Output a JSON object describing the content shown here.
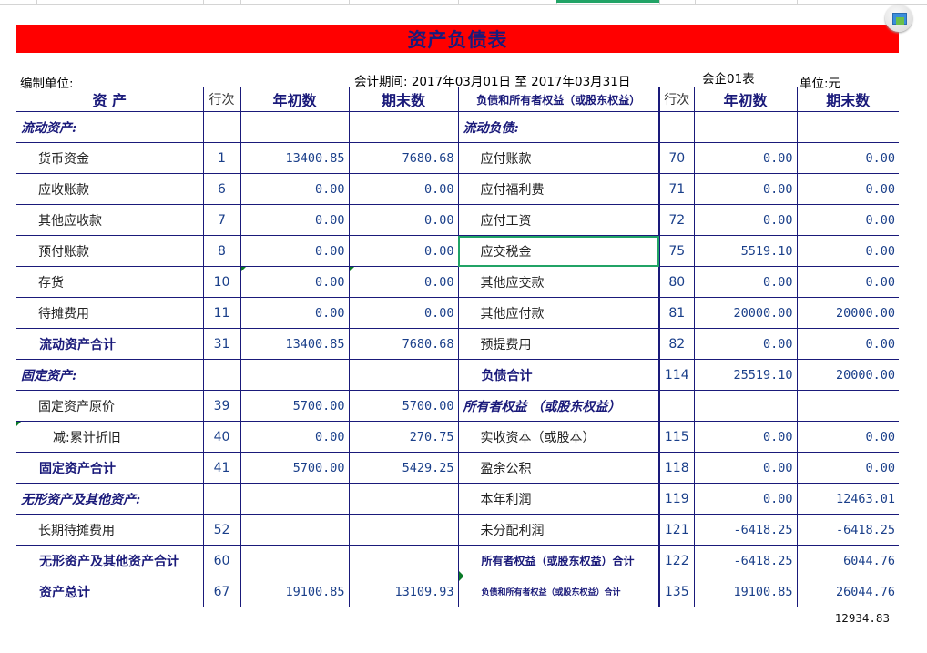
{
  "title": "资产负债表",
  "meta": {
    "unit_label": "编制单位:",
    "period": "会计期间:  2017年03月01日 至 2017年03月31日",
    "form_code": "会企01表",
    "currency": "单位:元"
  },
  "headers": {
    "assets": "资    产",
    "row_no": "行次",
    "begin": "年初数",
    "end": "期末数",
    "liabilities": "负债和所有者权益（或股东权益）"
  },
  "rows": [
    {
      "l_name": "流动资产:",
      "l_no": "",
      "l_begin": "",
      "l_end": "",
      "r_name": "流动负债:",
      "r_no": "",
      "r_begin": "",
      "r_end": ""
    },
    {
      "l_name": "货币资金",
      "l_no": "1",
      "l_begin": "13400.85",
      "l_end": "7680.68",
      "r_name": "应付账款",
      "r_no": "70",
      "r_begin": "0.00",
      "r_end": "0.00"
    },
    {
      "l_name": "应收账款",
      "l_no": "6",
      "l_begin": "0.00",
      "l_end": "0.00",
      "r_name": "应付福利费",
      "r_no": "71",
      "r_begin": "0.00",
      "r_end": "0.00"
    },
    {
      "l_name": "其他应收款",
      "l_no": "7",
      "l_begin": "0.00",
      "l_end": "0.00",
      "r_name": "应付工资",
      "r_no": "72",
      "r_begin": "0.00",
      "r_end": "0.00"
    },
    {
      "l_name": "预付账款",
      "l_no": "8",
      "l_begin": "0.00",
      "l_end": "0.00",
      "r_name": "应交税金",
      "r_no": "75",
      "r_begin": "5519.10",
      "r_end": "0.00"
    },
    {
      "l_name": "存货",
      "l_no": "10",
      "l_begin": "0.00",
      "l_end": "0.00",
      "r_name": "其他应交款",
      "r_no": "80",
      "r_begin": "0.00",
      "r_end": "0.00"
    },
    {
      "l_name": "待摊费用",
      "l_no": "11",
      "l_begin": "0.00",
      "l_end": "0.00",
      "r_name": "其他应付款",
      "r_no": "81",
      "r_begin": "20000.00",
      "r_end": "20000.00"
    },
    {
      "l_name": "流动资产合计",
      "l_no": "31",
      "l_begin": "13400.85",
      "l_end": "7680.68",
      "r_name": "预提费用",
      "r_no": "82",
      "r_begin": "0.00",
      "r_end": "0.00"
    },
    {
      "l_name": "固定资产:",
      "l_no": "",
      "l_begin": "",
      "l_end": "",
      "r_name": "负债合计",
      "r_no": "114",
      "r_begin": "25519.10",
      "r_end": "20000.00"
    },
    {
      "l_name": "固定资产原价",
      "l_no": "39",
      "l_begin": "5700.00",
      "l_end": "5700.00",
      "r_name": "所有者权益 （或股东权益）",
      "r_no": "",
      "r_begin": "",
      "r_end": ""
    },
    {
      "l_name": "减:累计折旧",
      "l_no": "40",
      "l_begin": "0.00",
      "l_end": "270.75",
      "r_name": "实收资本（或股本）",
      "r_no": "115",
      "r_begin": "0.00",
      "r_end": "0.00"
    },
    {
      "l_name": "固定资产合计",
      "l_no": "41",
      "l_begin": "5700.00",
      "l_end": "5429.25",
      "r_name": "盈余公积",
      "r_no": "118",
      "r_begin": "0.00",
      "r_end": "0.00"
    },
    {
      "l_name": "无形资产及其他资产:",
      "l_no": "",
      "l_begin": "",
      "l_end": "",
      "r_name": "本年利润",
      "r_no": "119",
      "r_begin": "0.00",
      "r_end": "12463.01"
    },
    {
      "l_name": "长期待摊费用",
      "l_no": "52",
      "l_begin": "",
      "l_end": "",
      "r_name": "未分配利润",
      "r_no": "121",
      "r_begin": "-6418.25",
      "r_end": "-6418.25"
    },
    {
      "l_name": "无形资产及其他资产合计",
      "l_no": "60",
      "l_begin": "",
      "l_end": "",
      "r_name": "所有者权益（或股东权益）合计",
      "r_no": "122",
      "r_begin": "-6418.25",
      "r_end": "6044.76"
    },
    {
      "l_name": "资产总计",
      "l_no": "67",
      "l_begin": "19100.85",
      "l_end": "13109.93",
      "r_name": "负债和所有者权益（或股东权益）合计",
      "r_no": "135",
      "r_begin": "19100.85",
      "r_end": "26044.76"
    }
  ],
  "check_total": "12934.83",
  "colors": {
    "title_band": "#ff0000",
    "text_accent": "#1a1a7a",
    "selection": "#21a366"
  },
  "icons": [
    "app-icon"
  ]
}
